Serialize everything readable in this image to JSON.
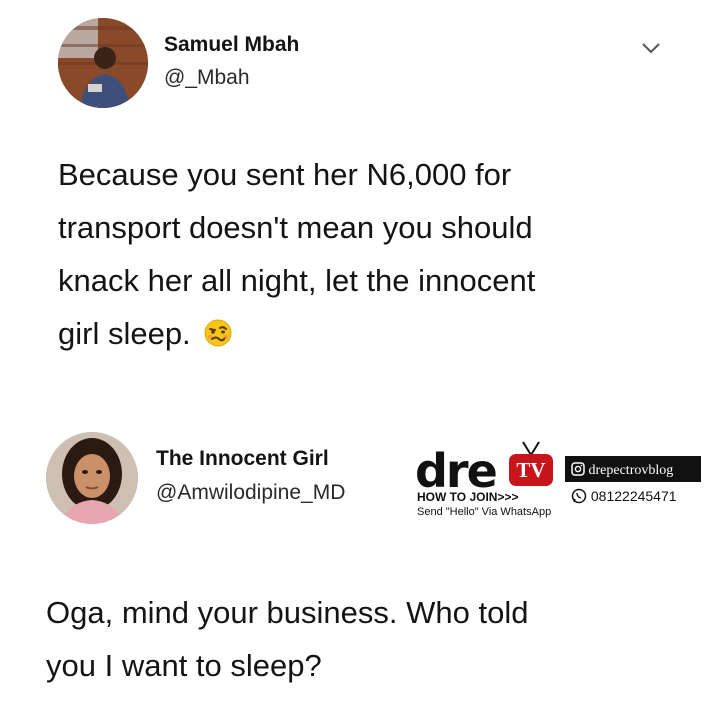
{
  "tweets": [
    {
      "name": "Samuel Mbah",
      "handle": "@_Mbah",
      "lines": [
        "Because you sent her N6,000 for",
        "transport doesn't mean you should",
        "knack her all night, let the innocent",
        "girl sleep."
      ],
      "emoji": "woozy-face-icon"
    },
    {
      "name": "The Innocent Girl",
      "handle": "@Amwilodipine_MD",
      "lines": [
        "Oga, mind your business. Who told",
        "you I want to sleep?"
      ]
    }
  ],
  "watermark": {
    "logo": "dre",
    "tv": "TV",
    "instagram": "drepectrovblog",
    "how_to_join": "HOW TO JOIN>>>",
    "phone": "08122245471",
    "send_hello": "Send \"Hello\" Via WhatsApp"
  },
  "colors": {
    "text": "#141414",
    "tv_red": "#c8151b",
    "whatsapp": "#2a2a2a"
  }
}
